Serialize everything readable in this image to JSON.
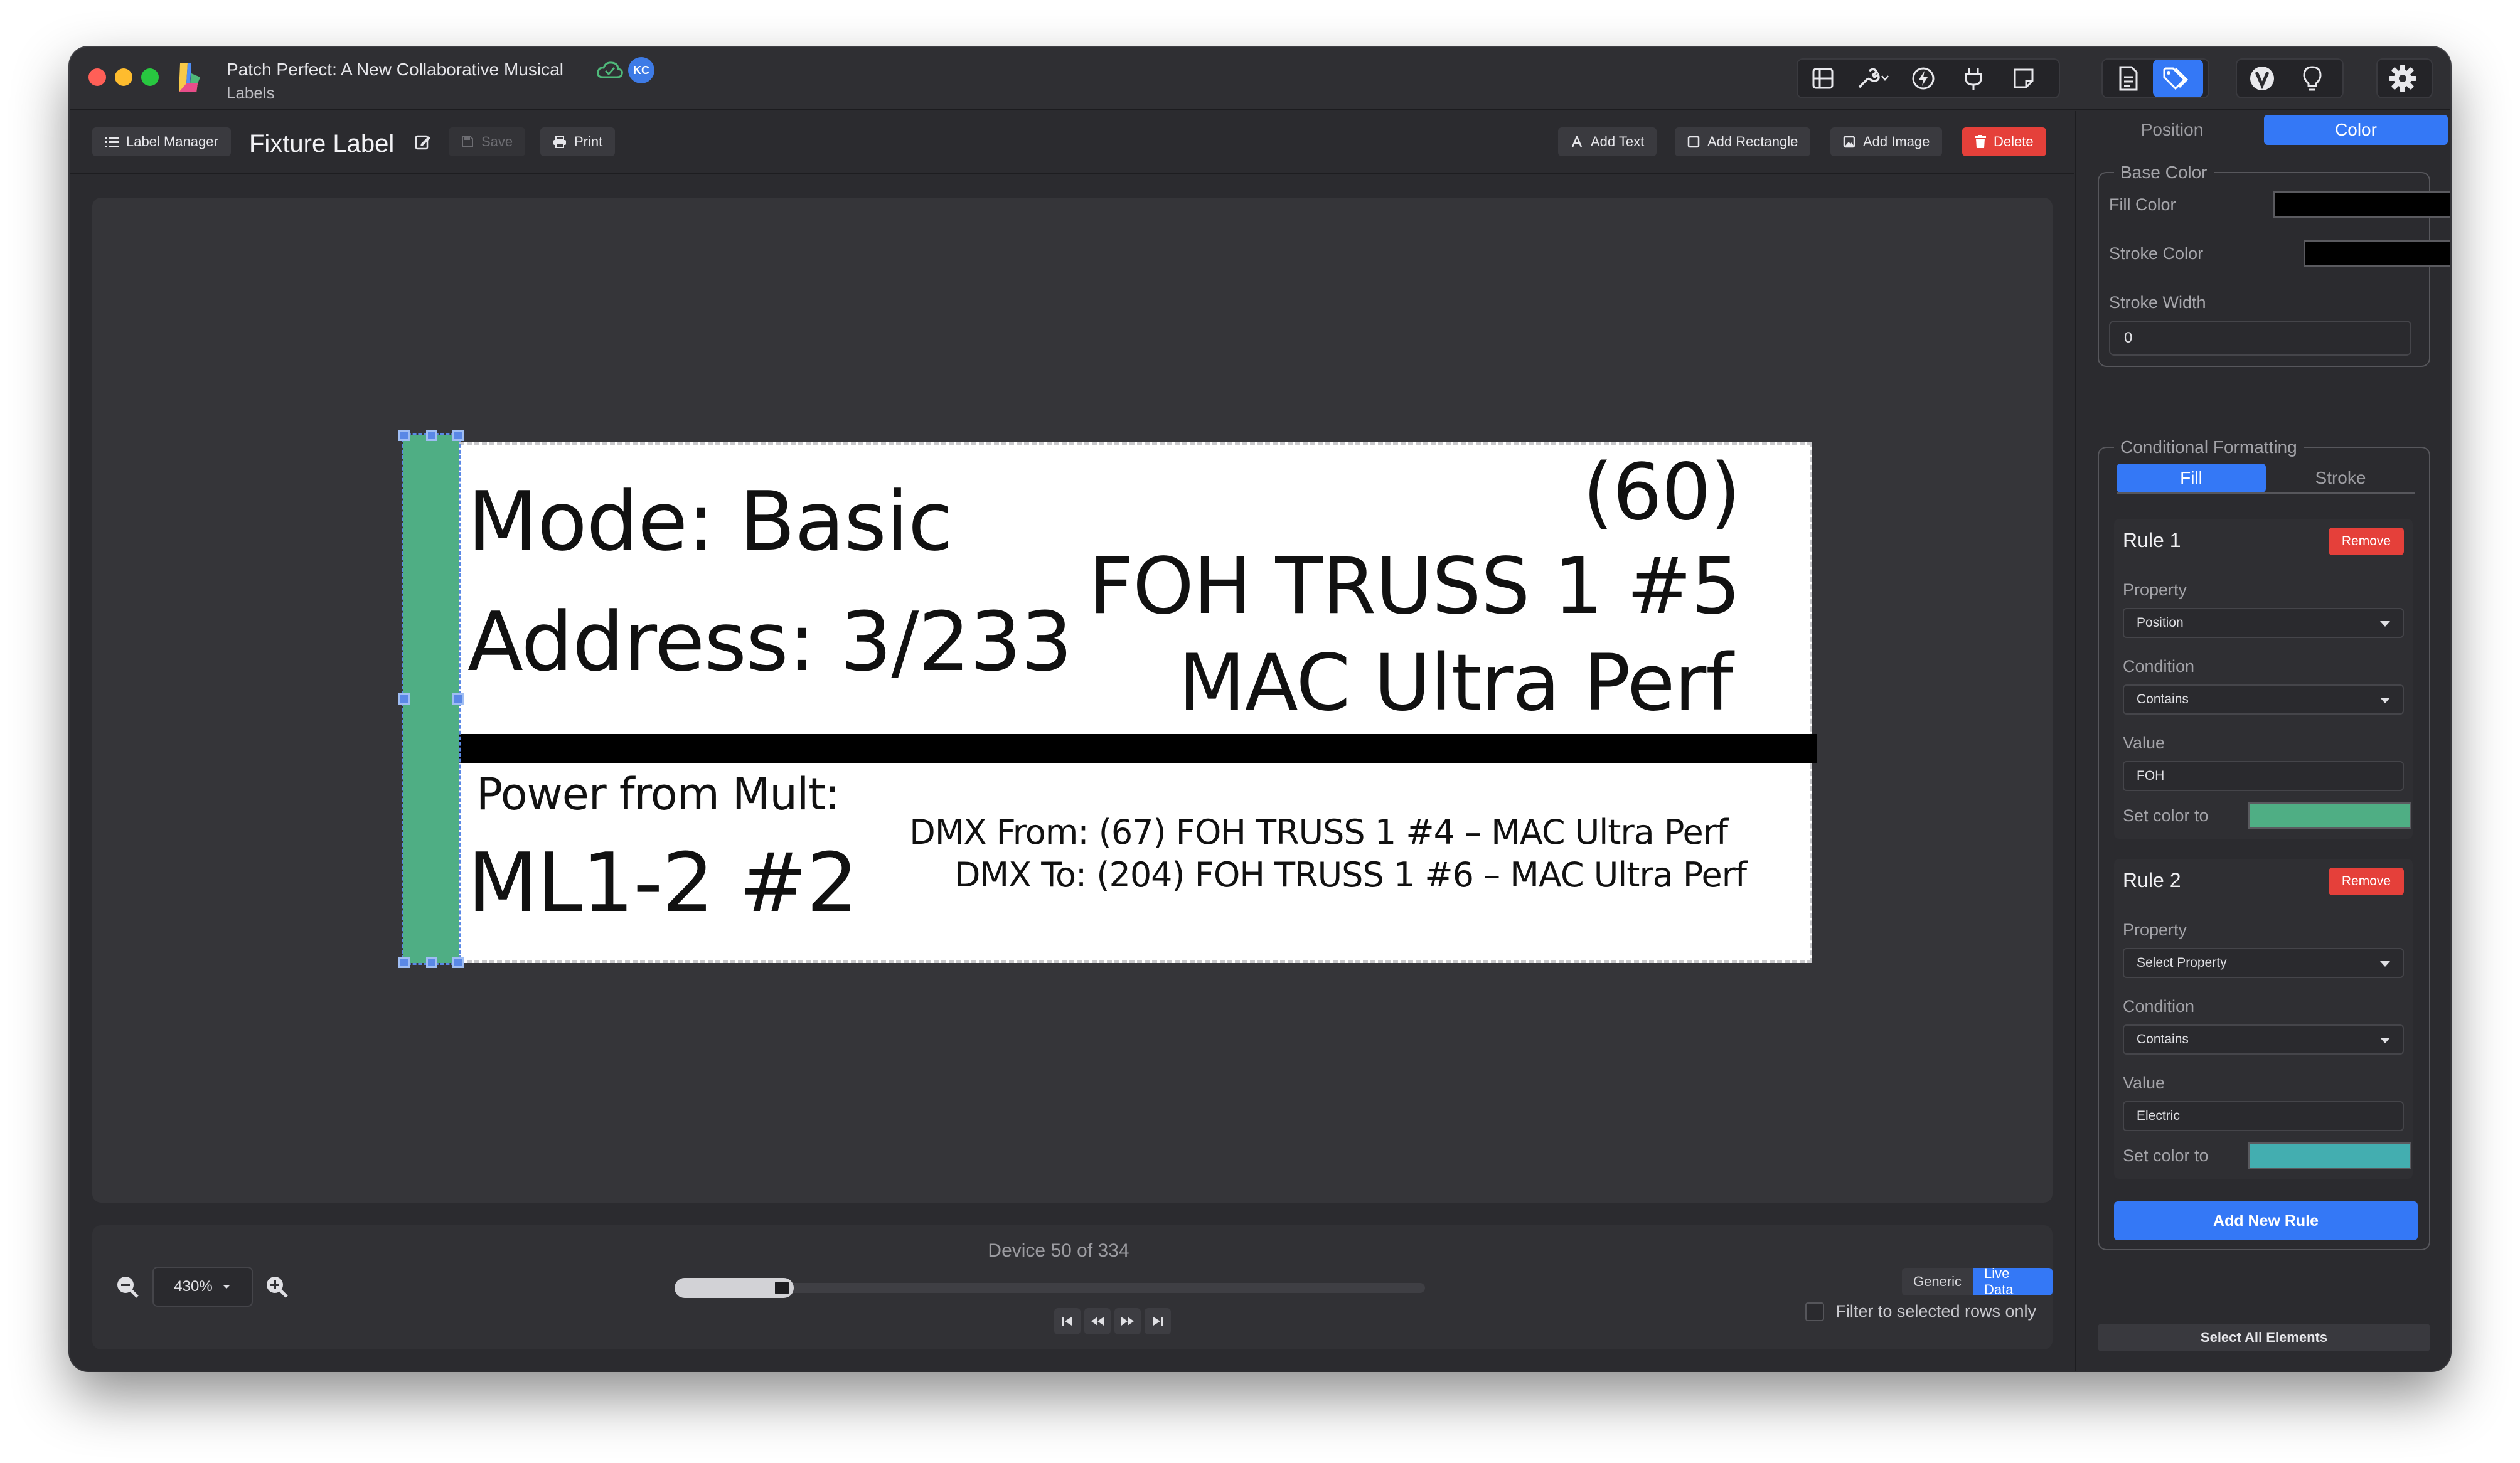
{
  "window": {
    "title": "Patch Perfect: A New Collaborative Musical",
    "subtitle": "Labels",
    "avatar_initials": "KC"
  },
  "titlebar_icons": [
    "layout-icon",
    "wrench-icon",
    "lightning-icon",
    "plug-icon",
    "note-icon",
    "document-icon",
    "tag-icon",
    "v-icon",
    "lightbulb-icon",
    "gear-icon"
  ],
  "toolbar": {
    "label_manager": "Label Manager",
    "doc_title": "Fixture Label",
    "save": "Save",
    "print": "Print",
    "add_text": "Add Text",
    "add_rectangle": "Add Rectangle",
    "add_image": "Add Image",
    "delete": "Delete"
  },
  "label": {
    "mode": "Mode: Basic",
    "address": "Address: 3/233",
    "channel": "(60)",
    "position": "FOH TRUSS 1 #5",
    "type": "MAC Ultra Perf",
    "power_label": "Power from Mult:",
    "power_value": "ML1-2 #2",
    "dmx_from": "DMX From: (67) FOH TRUSS 1 #4 – MAC Ultra Perf",
    "dmx_to": "DMX To: (204) FOH TRUSS 1 #6 – MAC Ultra Perf",
    "colors": {
      "bar": "#4fae84",
      "selection": "#5a88e6"
    }
  },
  "bottom": {
    "zoom": "430%",
    "device_count": "Device 50 of 334",
    "progress": 0.15,
    "mode_generic": "Generic",
    "mode_live": "Live Data",
    "filter_label": "Filter to selected rows only"
  },
  "panel": {
    "tab_position": "Position",
    "tab_color": "Color",
    "base_color": {
      "legend": "Base Color",
      "fill_label": "Fill Color",
      "stroke_label": "Stroke Color",
      "width_label": "Stroke Width",
      "width_value": "0",
      "fill_value": "#000000",
      "stroke_value": "#000000"
    },
    "conditional": {
      "legend": "Conditional Formatting",
      "tab_fill": "Fill",
      "tab_stroke": "Stroke",
      "rules": [
        {
          "title": "Rule 1",
          "remove": "Remove",
          "property_label": "Property",
          "property": "Position",
          "condition_label": "Condition",
          "condition": "Contains",
          "value_label": "Value",
          "value": "FOH",
          "set_color_label": "Set color to",
          "color": "#4fae84"
        },
        {
          "title": "Rule 2",
          "remove": "Remove",
          "property_label": "Property",
          "property": "Select Property",
          "condition_label": "Condition",
          "condition": "Contains",
          "value_label": "Value",
          "value": "Electric",
          "set_color_label": "Set color to",
          "color": "#43aeb0"
        }
      ],
      "add_rule": "Add New Rule"
    },
    "select_all": "Select All Elements"
  }
}
